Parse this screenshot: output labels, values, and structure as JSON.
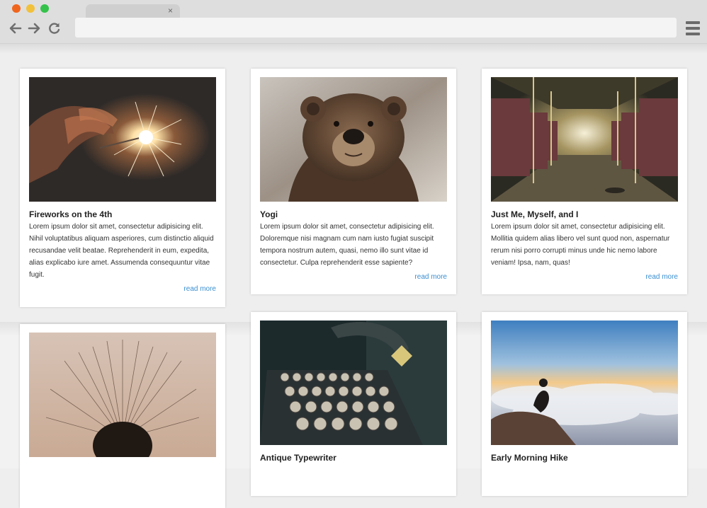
{
  "browser": {
    "address_value": "",
    "tab_close": "×"
  },
  "cards": [
    {
      "title": "Fireworks on the 4th",
      "text": "Lorem ipsum dolor sit amet, consectetur adipisicing elit. Nihil voluptatibus aliquam asperiores, cum distinctio aliquid recusandae velit beatae. Reprehenderit in eum, expedita, alias explicabo iure amet. Assumenda consequuntur vitae fugit.",
      "link": "read more"
    },
    {
      "title": "Yogi",
      "text": "Lorem ipsum dolor sit amet, consectetur adipisicing elit. Doloremque nisi magnam cum nam iusto fugiat suscipit tempora nostrum autem, quasi, nemo illo sunt vitae id consectetur. Culpa reprehenderit esse sapiente?",
      "link": "read more"
    },
    {
      "title": "Just Me, Myself, and I",
      "text": "Lorem ipsum dolor sit amet, consectetur adipisicing elit. Mollitia quidem alias libero vel sunt quod non, aspernatur rerum nisi porro corrupti minus unde hic nemo labore veniam! Ipsa, nam, quas!",
      "link": "read more"
    },
    {
      "title": "",
      "text": "",
      "link": ""
    },
    {
      "title": "Antique Typewriter",
      "text": "",
      "link": ""
    },
    {
      "title": "Early Morning Hike",
      "text": "",
      "link": ""
    }
  ],
  "colors": {
    "link": "#3a8fd1",
    "chrome": "#dedede",
    "page_background": "#eeeeee"
  },
  "icons": [
    "back-arrow-icon",
    "forward-arrow-icon",
    "reload-icon",
    "hamburger-menu-icon",
    "close-icon"
  ]
}
